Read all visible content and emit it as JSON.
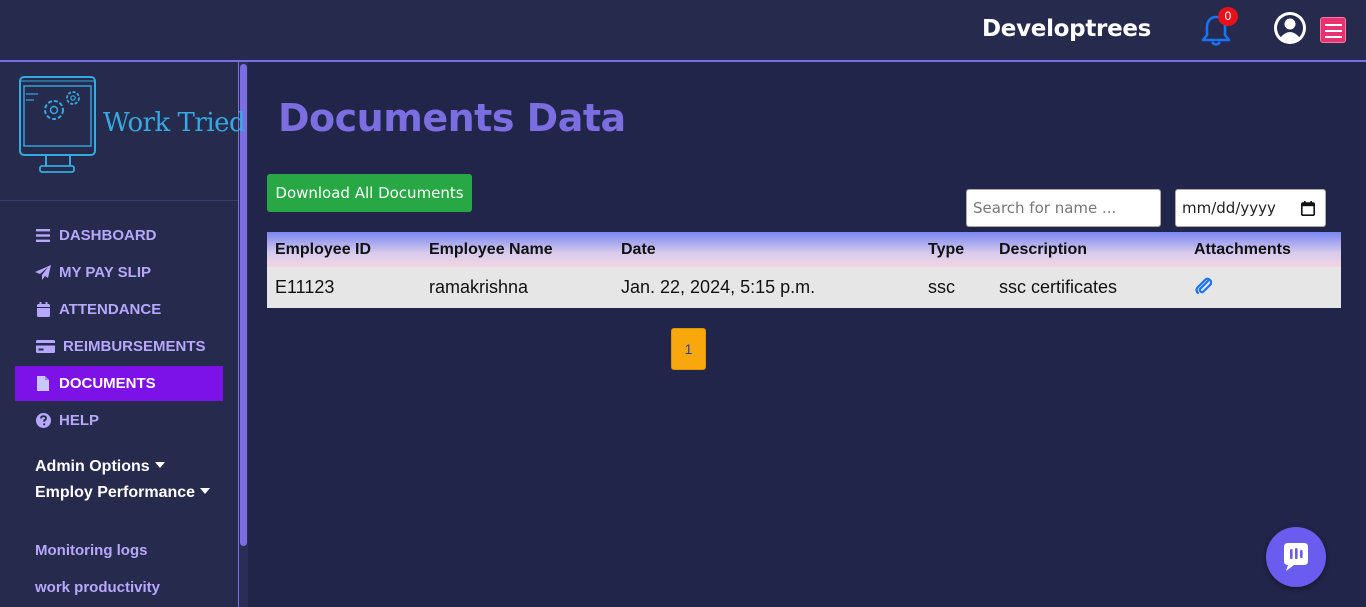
{
  "header": {
    "brand": "Developtrees",
    "notification_count": "0"
  },
  "logo": {
    "text": "Work Tried"
  },
  "sidebar": {
    "items": [
      {
        "label": "DASHBOARD",
        "icon": "bars-icon"
      },
      {
        "label": "MY PAY SLIP",
        "icon": "paper-plane-icon"
      },
      {
        "label": "ATTENDANCE",
        "icon": "calendar-icon"
      },
      {
        "label": "REIMBURSEMENTS",
        "icon": "credit-card-icon"
      },
      {
        "label": "DOCUMENTS",
        "icon": "file-icon",
        "active": true
      },
      {
        "label": "HELP",
        "icon": "question-circle-icon"
      }
    ],
    "admin_options": "Admin Options",
    "employ_performance": "Employ Performance",
    "links": [
      "Monitoring logs",
      "work productivity"
    ]
  },
  "main": {
    "title": "Documents Data",
    "download_label": "Download All Documents",
    "search_placeholder": "Search for name ...",
    "date_placeholder": "mm/dd/yyyy",
    "table": {
      "headers": [
        "Employee ID",
        "Employee Name",
        "Date",
        "Type",
        "Description",
        "Attachments"
      ],
      "rows": [
        {
          "employee_id": "E11123",
          "employee_name": "ramakrishna",
          "date": "Jan. 22, 2024, 5:15 p.m.",
          "type": "ssc",
          "description": "ssc certificates",
          "attachment_icon": "paperclip-icon"
        }
      ]
    },
    "pagination": {
      "current": "1"
    }
  },
  "colors": {
    "background": "#22254a",
    "accent": "#7b6ee0",
    "active_nav": "#7d12e8",
    "download_button": "#28a745",
    "page_button": "#f8a80c",
    "badge": "#e8101b"
  }
}
